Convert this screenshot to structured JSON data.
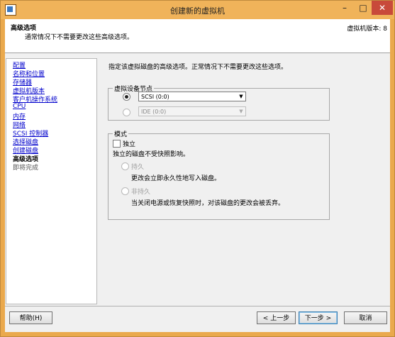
{
  "window": {
    "title": "创建新的虚拟机",
    "minimize": "–",
    "maximize": "□",
    "close": "✕"
  },
  "header": {
    "title": "高级选项",
    "subtitle": "通常情况下不需要更改这些高级选项。",
    "version": "虚拟机版本: 8"
  },
  "sidebar": {
    "items": [
      {
        "label": "配置",
        "state": "link"
      },
      {
        "label": "名称和位置",
        "state": "link"
      },
      {
        "label": "存储器",
        "state": "link"
      },
      {
        "label": "虚拟机版本",
        "state": "link"
      },
      {
        "label": "客户机操作系统",
        "state": "link"
      },
      {
        "label": "CPU",
        "state": "link"
      },
      {
        "label": "内存",
        "state": "link"
      },
      {
        "label": "网络",
        "state": "link"
      },
      {
        "label": "SCSI 控制器",
        "state": "link"
      },
      {
        "label": "选择磁盘",
        "state": "link"
      },
      {
        "label": "创建磁盘",
        "state": "link"
      },
      {
        "label": "高级选项",
        "state": "current"
      },
      {
        "label": "即将完成",
        "state": "future"
      }
    ]
  },
  "main": {
    "description": "指定该虚拟磁盘的高级选项。正常情况下不需要更改这些选项。",
    "device_node": {
      "label": "虚拟设备节点",
      "scsi_value": "SCSI (0:0)",
      "ide_value": "IDE (0:0)"
    },
    "mode": {
      "label": "模式",
      "independent_label": "独立",
      "independent_desc": "独立的磁盘不受快照影响。",
      "persistent_label": "持久",
      "persistent_desc": "更改会立即永久性地写入磁盘。",
      "nonpersistent_label": "非持久",
      "nonpersistent_desc": "当关闭电源或恢复快照时，对该磁盘的更改会被丢弃。"
    }
  },
  "footer": {
    "help": "帮助(H)",
    "back": "< 上一步",
    "next": "下一步 >",
    "cancel": "取消"
  },
  "colors": {
    "titlebar": "#f0b35a",
    "link": "#0000cc",
    "close": "#c84a3a"
  }
}
